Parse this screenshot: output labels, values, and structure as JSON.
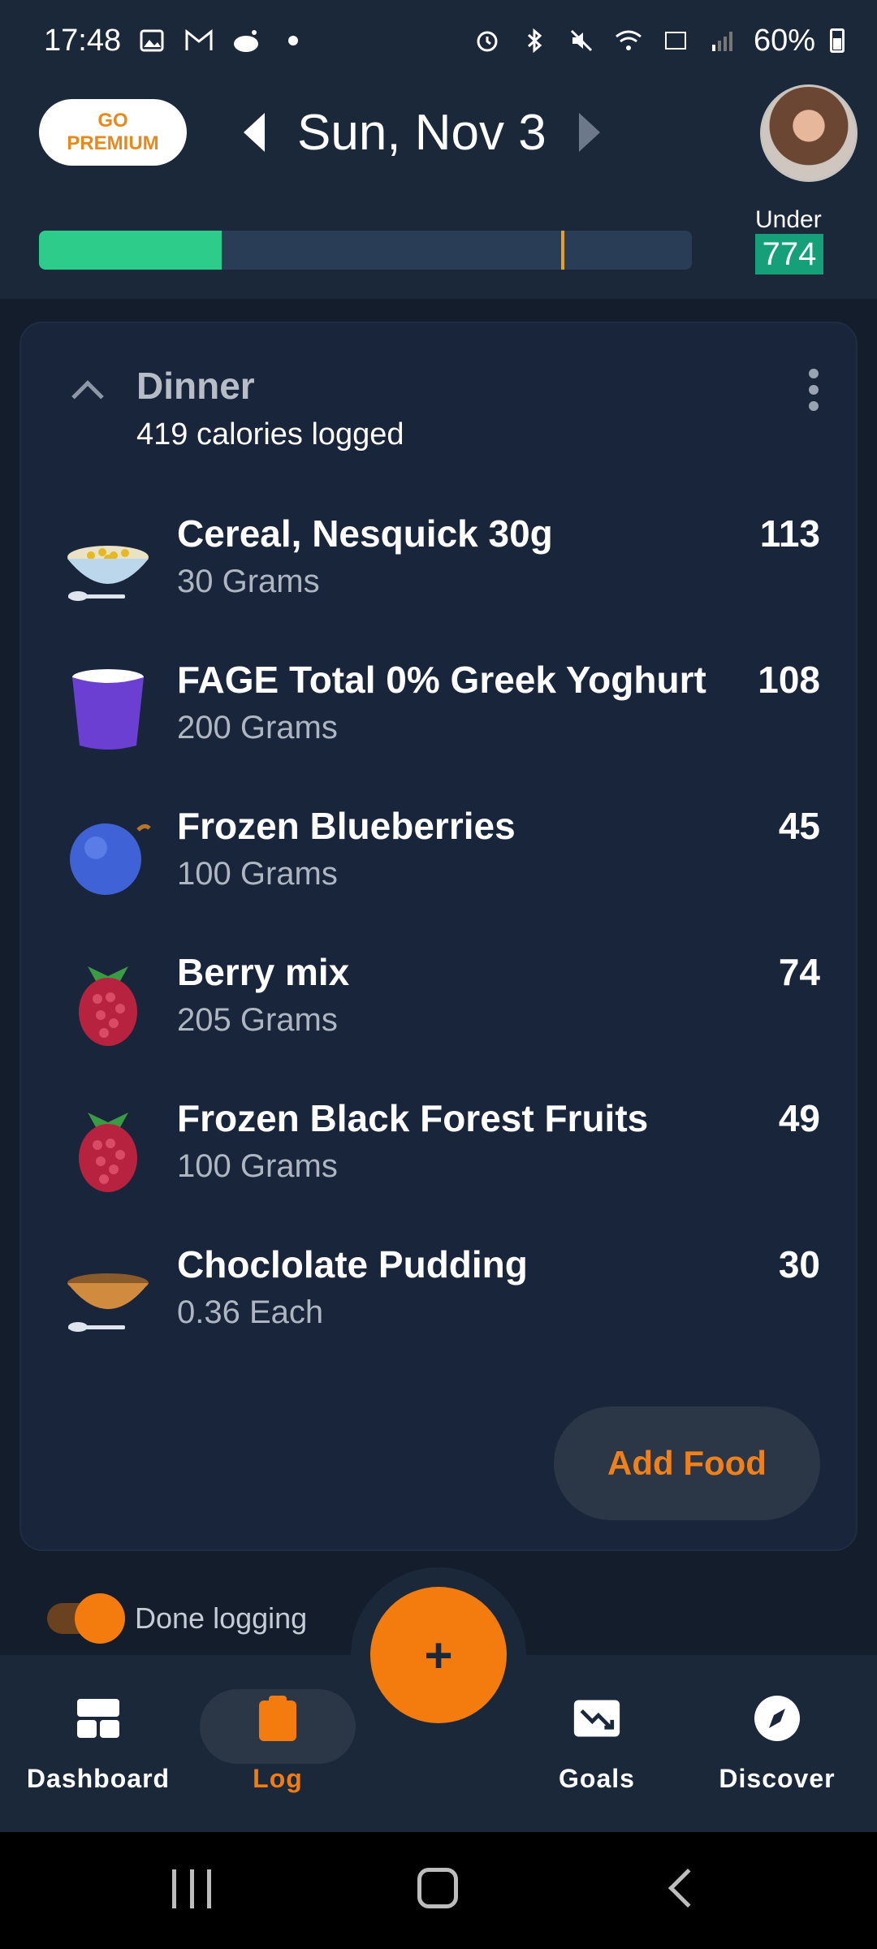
{
  "status_bar": {
    "time": "17:48",
    "battery": "60%"
  },
  "header": {
    "premium_line1": "GO",
    "premium_line2": "PREMIUM",
    "date": "Sun, Nov 3"
  },
  "progress": {
    "consumed_fraction": 0.28,
    "goal_marker_fraction": 0.8,
    "under_label": "Under",
    "under_value": "774",
    "fill_color": "#2ecc8a",
    "marker_color": "#e8a11a"
  },
  "meal": {
    "title": "Dinner",
    "subtitle": "419 calories logged",
    "foods": [
      {
        "name": "Cereal, Nesquick 30g",
        "portion": "30 Grams",
        "calories": "113",
        "icon": "cereal-bowl-icon"
      },
      {
        "name": "FAGE Total 0% Greek Yoghurt",
        "portion": "200 Grams",
        "calories": "108",
        "icon": "yogurt-cup-icon"
      },
      {
        "name": "Frozen Blueberries",
        "portion": "100 Grams",
        "calories": "45",
        "icon": "blueberry-icon"
      },
      {
        "name": "Berry mix",
        "portion": "205 Grams",
        "calories": "74",
        "icon": "raspberry-icon"
      },
      {
        "name": "Frozen Black Forest Fruits",
        "portion": "100 Grams",
        "calories": "49",
        "icon": "raspberry-icon"
      },
      {
        "name": "Choclolate Pudding",
        "portion": "0.36 Each",
        "calories": "30",
        "icon": "pudding-bowl-icon"
      }
    ],
    "add_food_label": "Add Food"
  },
  "done_logging": {
    "label": "Done logging",
    "enabled": true
  },
  "bottom_nav": {
    "items": [
      {
        "label": "Dashboard",
        "icon": "dashboard-icon",
        "active": false
      },
      {
        "label": "Log",
        "icon": "clipboard-icon",
        "active": true
      },
      {
        "label": "Goals",
        "icon": "trending-down-icon",
        "active": false
      },
      {
        "label": "Discover",
        "icon": "compass-icon",
        "active": false
      }
    ],
    "fab_label": "+",
    "accent_color": "#f47c0e"
  }
}
